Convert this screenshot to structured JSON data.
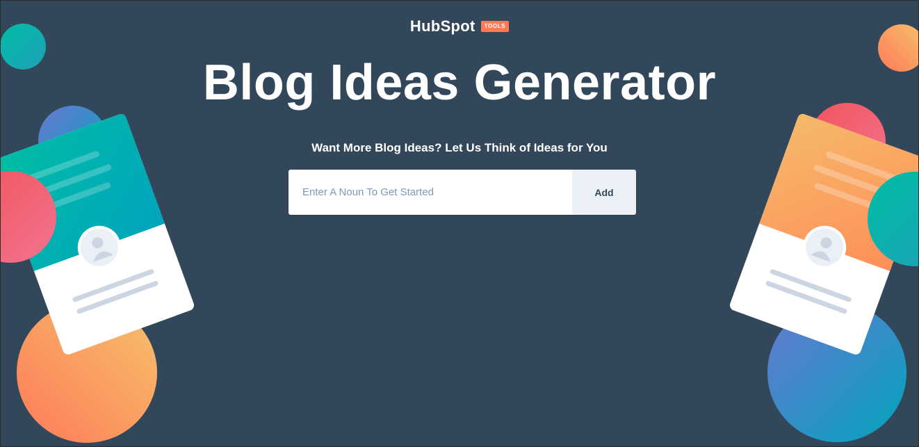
{
  "header": {
    "logo_text": "HubSpot",
    "logo_badge": "TOOLS"
  },
  "hero": {
    "title": "Blog Ideas Generator",
    "subtitle": "Want More Blog Ideas? Let Us Think of Ideas for You"
  },
  "form": {
    "input_placeholder": "Enter A Noun To Get Started",
    "input_value": "",
    "add_label": "Add"
  },
  "colors": {
    "background": "#33475b",
    "brand_orange": "#ff7a59",
    "button_bg": "#eaf0f6",
    "placeholder_text": "#7c98b6",
    "teal": "#00bda5",
    "coral": "#f2545b"
  },
  "decorations": {
    "left_card": "profile-card-illustration",
    "right_card": "profile-card-illustration"
  }
}
